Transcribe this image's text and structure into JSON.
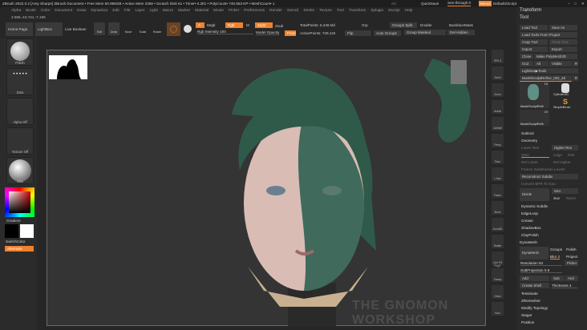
{
  "titlebar": {
    "text": "ZBrush 2022.0.2 [Amy Sharpe]  ZBrush Document   • Free Mem 50.996GB • Active Mem 2358 • Scratch Disk 61 • Timer• 0.301 • PolyCount• 740.653 KP • MeshCount• 1",
    "ac": "AC",
    "quicksave": "QuickSave",
    "see_through": "See-through  0",
    "menus": "Menus",
    "defaultzscript": "DefaultZScript"
  },
  "menu": [
    "Alpha",
    "Brush",
    "Color",
    "Document",
    "Draw",
    "Dynamics",
    "Edit",
    "File",
    "Layer",
    "Light",
    "Macro",
    "Marker",
    "Material",
    "Movie",
    "Picker",
    "Preferences",
    "Render",
    "Stencil",
    "Stroke",
    "Texture",
    "Tool",
    "Transform",
    "Zplugin",
    "Zscript",
    "Help"
  ],
  "coords": "3.696,-10.741,-7.196",
  "toolbar": {
    "home": "Home Page",
    "lightbox": "LightBox",
    "live_boolean": "Live Boolean",
    "edit": "Edit",
    "draw": "Draw",
    "move": "Move",
    "scale": "Scale",
    "rotate": "Rotate",
    "a": "A",
    "mrgb": "Mrgb",
    "rgb": "Rgb",
    "m": "M",
    "zadd": "Zadd",
    "zsub": "Zsub",
    "rgb_intensity": "Rgb Intensity 100",
    "model_opacity": "Model Opacity",
    "front": "Front",
    "total_points": "TotalPoints: 5.449 Mil",
    "active_points": "ActivePoints: 729,119",
    "grp": "Grp",
    "flip": "Flip",
    "groups_split": "Groups Split",
    "auto_groups": "Auto Groups",
    "double": "Double",
    "group_masked": "Group Masked",
    "backface_mask": "BackfaceMask",
    "del_hidden": "Del Hidden"
  },
  "leftshelf": {
    "brush": "Polish",
    "stroke": "Dots",
    "alpha": "Alpha Off",
    "texture": "Texture Off",
    "material": "Skin",
    "gradient": "Gradient",
    "switch_color": "SwitchColor",
    "alternate": "Alternate"
  },
  "rightshelf": [
    "SPix 3",
    "Scroll",
    "Zoom",
    "Actual",
    "AAHalf",
    "Persp",
    "Floor",
    "L.Sym",
    "Frame",
    "Move",
    "Zoom3D",
    "Rotate",
    "Line Fill PolyF",
    "Transp",
    "Ghost",
    "Solo"
  ],
  "panel": {
    "transform": "Transform",
    "tool": "Tool",
    "load_tool": "Load Tool",
    "save_as": "Save As",
    "load_from_project": "Load Tools From Project",
    "copy_tool": "Copy Tool",
    "paste_tool": "Paste Tool",
    "import": "Import",
    "export": "Export",
    "clone": "Clone",
    "make_polymesh": "Make PolyMesh3D",
    "goz": "GoZ",
    "all": "All",
    "visible": "Visible",
    "r": "R",
    "lightbox_tools": "Lightbox▶Tools",
    "current_tool": "ModelSculptRefine_002_48",
    "thumb1": "ModelSculptRefir",
    "thumb1_count": "19",
    "cylinder": "Cylinder3D",
    "simplebrush": "SimpleBrush",
    "thumb3": "ModelSculptRefir",
    "thumb3_count": "19",
    "subtool": "Subtool",
    "geometry": "Geometry",
    "lower_res": "Lower Res",
    "higher_res": "Higher Res",
    "sdiv": "SDiv",
    "cage": "Cage",
    "rstr": "Rstr",
    "del_lower": "Del Lower",
    "del_higher": "Del Higher",
    "freeze": "Freeze SubDivision Levels",
    "reconstruct": "Reconstruct Subdiv",
    "convert_bpr": "Convert BPR To Geo",
    "divide": "Divide",
    "smt": "Smt",
    "suv": "Suv",
    "reuv": "ReUV",
    "dynamic_subdiv": "Dynamic Subdiv",
    "edgeloop": "EdgeLoop",
    "crease": "Crease",
    "shadowbox": "ShadowBox",
    "claypolish": "ClayPolish",
    "dynamesh_header": "DynaMesh",
    "dynamesh": "DynaMesh",
    "groups": "Groups",
    "polish": "Polish",
    "blur": "Blur 2",
    "project": "Project",
    "resolution": "Resolution 64",
    "picker": "Picker",
    "subprojection": "SubProjection 0.6",
    "add": "Add",
    "sub": "Sub",
    "and": "And",
    "create_shell": "Create Shell",
    "thickness": "Thickness 4",
    "tessimate": "Tessimate",
    "zremesher": "ZRemesher",
    "modify_topology": "Modify Topology",
    "stager": "Stager",
    "position": "Position"
  },
  "watermark": "THE GNOMON WORKSHOP",
  "colors": {
    "accent": "#f0812c",
    "hair": "#2f5a4a",
    "skin": "#d9bcb4"
  }
}
